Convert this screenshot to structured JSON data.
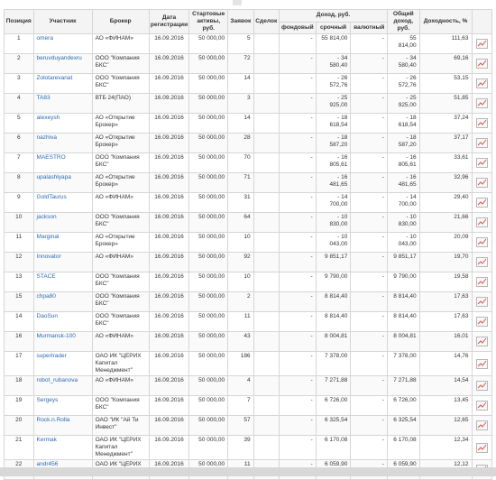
{
  "header": {
    "position": "Позиция",
    "participant": "Участник",
    "broker": "Брокер",
    "reg_date": "Дата регистрации",
    "start_assets": "Стартовые активы, руб.",
    "orders": "Заявок",
    "deals": "Сделок",
    "income": "Доход, руб.",
    "income_stock": "фондовый",
    "income_futures": "срочный",
    "income_currency": "валютный",
    "total_income": "Общий доход, руб.",
    "yield": "Доходность, %"
  },
  "rows": [
    {
      "pos": "1",
      "user": "omera",
      "broker": "АО «ФИНАМ»",
      "date": "16.09.2016",
      "assets": "50 000,00",
      "orders": "5",
      "deals": "",
      "stock": "-",
      "futures": "55 814,00",
      "currency": "-",
      "total": "55 814,00",
      "yield": "111,63"
    },
    {
      "pos": "2",
      "user": "beruvduyandexru",
      "broker": "ООО \"Компания БКС\"",
      "date": "16.09.2016",
      "assets": "50 000,00",
      "orders": "72",
      "deals": "",
      "stock": "-",
      "futures": "- 34 580,40",
      "currency": "-",
      "total": "- 34 580,40",
      "yield": "69,16"
    },
    {
      "pos": "3",
      "user": "Zolotarevanat",
      "broker": "ООО \"Компания БКС\"",
      "date": "16.09.2016",
      "assets": "50 000,00",
      "orders": "14",
      "deals": "",
      "stock": "-",
      "futures": "- 26 572,76",
      "currency": "-",
      "total": "- 26 572,76",
      "yield": "53,15"
    },
    {
      "pos": "4",
      "user": "TA83",
      "broker": "ВТБ 24(ПАО)",
      "date": "16.09.2016",
      "assets": "50 000,00",
      "orders": "3",
      "deals": "",
      "stock": "-",
      "futures": "- 25 925,00",
      "currency": "-",
      "total": "- 25 925,00",
      "yield": "51,85"
    },
    {
      "pos": "5",
      "user": "alexeysh",
      "broker": "АО «Открытие Брокер»",
      "date": "16.09.2016",
      "assets": "50 000,00",
      "orders": "14",
      "deals": "",
      "stock": "-",
      "futures": "- 18 618,54",
      "currency": "-",
      "total": "- 18 618,54",
      "yield": "37,24"
    },
    {
      "pos": "6",
      "user": "nazhiva",
      "broker": "АО «Открытие Брокер»",
      "date": "16.09.2016",
      "assets": "50 000,00",
      "orders": "28",
      "deals": "",
      "stock": "-",
      "futures": "- 18 587,20",
      "currency": "-",
      "total": "- 18 587,20",
      "yield": "37,17"
    },
    {
      "pos": "7",
      "user": "MAESTRO",
      "broker": "ООО \"Компания БКС\"",
      "date": "16.09.2016",
      "assets": "50 000,00",
      "orders": "70",
      "deals": "",
      "stock": "-",
      "futures": "- 16 805,61",
      "currency": "-",
      "total": "- 16 805,61",
      "yield": "33,61"
    },
    {
      "pos": "8",
      "user": "upalashlyapa",
      "broker": "АО «Открытие Брокер»",
      "date": "16.09.2016",
      "assets": "50 000,00",
      "orders": "71",
      "deals": "",
      "stock": "-",
      "futures": "- 16 481,65",
      "currency": "-",
      "total": "- 16 481,65",
      "yield": "32,96"
    },
    {
      "pos": "9",
      "user": "GoldTaurus",
      "broker": "АО «ФИНАМ»",
      "date": "16.09.2016",
      "assets": "50 000,00",
      "orders": "31",
      "deals": "",
      "stock": "-",
      "futures": "- 14 700,00",
      "currency": "-",
      "total": "- 14 700,00",
      "yield": "29,40"
    },
    {
      "pos": "10",
      "user": "jackson",
      "broker": "ООО \"Компания БКС\"",
      "date": "16.09.2016",
      "assets": "50 000,00",
      "orders": "64",
      "deals": "",
      "stock": "-",
      "futures": "- 10 830,00",
      "currency": "-",
      "total": "- 10 830,00",
      "yield": "21,66"
    },
    {
      "pos": "11",
      "user": "Marginal",
      "broker": "АО «Открытие Брокер»",
      "date": "16.09.2016",
      "assets": "50 000,00",
      "orders": "10",
      "deals": "",
      "stock": "-",
      "futures": "- 10 043,00",
      "currency": "-",
      "total": "- 10 043,00",
      "yield": "20,09"
    },
    {
      "pos": "12",
      "user": "Innovator",
      "broker": "АО «ФИНАМ»",
      "date": "16.09.2016",
      "assets": "50 000,00",
      "orders": "92",
      "deals": "",
      "stock": "-",
      "futures": "9 851,17",
      "currency": "-",
      "total": "9 851,17",
      "yield": "19,70"
    },
    {
      "pos": "13",
      "user": "STACE",
      "broker": "ООО \"Компания БКС\"",
      "date": "16.09.2016",
      "assets": "50 000,00",
      "orders": "10",
      "deals": "",
      "stock": "-",
      "futures": "9 790,00",
      "currency": "-",
      "total": "9 790,00",
      "yield": "19,58"
    },
    {
      "pos": "15",
      "user": "chpa80",
      "broker": "ООО \"Компания БКС\"",
      "date": "16.09.2016",
      "assets": "50 000,00",
      "orders": "2",
      "deals": "",
      "stock": "-",
      "futures": "8 814,40",
      "currency": "-",
      "total": "8 814,40",
      "yield": "17,63"
    },
    {
      "pos": "14",
      "user": "DaoSun",
      "broker": "ООО \"Компания БКС\"",
      "date": "16.09.2016",
      "assets": "50 000,00",
      "orders": "11",
      "deals": "",
      "stock": "-",
      "futures": "8 814,40",
      "currency": "-",
      "total": "8 814,40",
      "yield": "17,63"
    },
    {
      "pos": "16",
      "user": "Murmansk-100",
      "broker": "АО «ФИНАМ»",
      "date": "16.09.2016",
      "assets": "50 000,00",
      "orders": "43",
      "deals": "",
      "stock": "-",
      "futures": "8 004,81",
      "currency": "-",
      "total": "8 004,81",
      "yield": "16,01"
    },
    {
      "pos": "17",
      "user": "supertrader",
      "broker": "ОАО ИК \"ЦЕРИХ Капитал Менеджмент\"",
      "date": "16.09.2016",
      "assets": "50 000,00",
      "orders": "186",
      "deals": "",
      "stock": "-",
      "futures": "7 378,00",
      "currency": "-",
      "total": "7 378,00",
      "yield": "14,76"
    },
    {
      "pos": "18",
      "user": "robot_rubanova",
      "broker": "АО «ФИНАМ»",
      "date": "16.09.2016",
      "assets": "50 000,00",
      "orders": "4",
      "deals": "",
      "stock": "-",
      "futures": "7 271,88",
      "currency": "-",
      "total": "7 271,88",
      "yield": "14,54"
    },
    {
      "pos": "19",
      "user": "Sergeys",
      "broker": "ООО \"Компания БКС\"",
      "date": "16.09.2016",
      "assets": "50 000,00",
      "orders": "7",
      "deals": "",
      "stock": "-",
      "futures": "6 726,00",
      "currency": "-",
      "total": "6 726,00",
      "yield": "13,45"
    },
    {
      "pos": "20",
      "user": "Rock.n.Rolla",
      "broker": "ОАО \"ИК \"Ай Ти Инвест\"",
      "date": "16.09.2016",
      "assets": "50 000,00",
      "orders": "57",
      "deals": "",
      "stock": "-",
      "futures": "6 325,54",
      "currency": "-",
      "total": "6 325,54",
      "yield": "12,65"
    },
    {
      "pos": "21",
      "user": "Kermak",
      "broker": "ОАО ИК \"ЦЕРИХ Капитал Менеджмент\"",
      "date": "16.09.2016",
      "assets": "50 000,00",
      "orders": "39",
      "deals": "",
      "stock": "-",
      "futures": "6 170,08",
      "currency": "-",
      "total": "6 170,08",
      "yield": "12,34"
    },
    {
      "pos": "22",
      "user": "andr456",
      "broker": "ОАО ИК \"ЦЕРИХ",
      "date": "16.09.2016",
      "assets": "50 000,00",
      "orders": "11",
      "deals": "",
      "stock": "-",
      "futures": "6 059,90",
      "currency": "-",
      "total": "6 059,90",
      "yield": "12,12"
    }
  ],
  "icons": {
    "chart": "chart-line-icon"
  },
  "colors": {
    "link": "#2a6bb4",
    "header_bg": "#f4f4f4",
    "border": "#d6d6d6",
    "chart_line": "#d9534f"
  }
}
